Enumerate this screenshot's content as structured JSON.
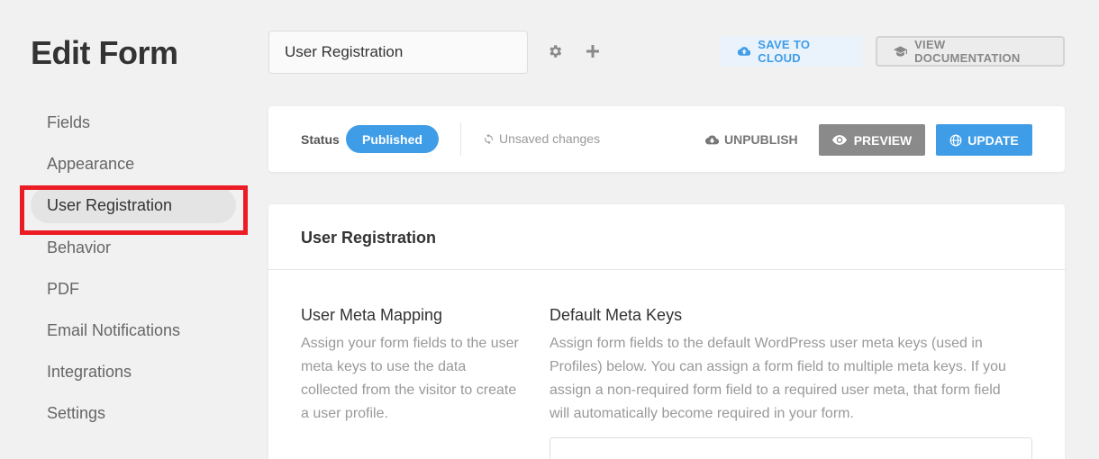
{
  "header": {
    "title": "Edit Form",
    "form_name": "User Registration",
    "save_to_cloud_label": "SAVE TO CLOUD",
    "view_docs_label": "VIEW DOCUMENTATION"
  },
  "sidebar": {
    "items": [
      {
        "label": "Fields"
      },
      {
        "label": "Appearance"
      },
      {
        "label": "User Registration",
        "active": true
      },
      {
        "label": "Behavior"
      },
      {
        "label": "PDF"
      },
      {
        "label": "Email Notifications"
      },
      {
        "label": "Integrations"
      },
      {
        "label": "Settings"
      }
    ]
  },
  "status_bar": {
    "status_label": "Status",
    "status_value": "Published",
    "unsaved_text": "Unsaved changes",
    "unpublish_label": "UNPUBLISH",
    "preview_label": "PREVIEW",
    "update_label": "UPDATE"
  },
  "panel": {
    "title": "User Registration",
    "left_heading": "User Meta Mapping",
    "left_desc": "Assign your form fields to the user meta keys to use the data collected from the visitor to create a user profile.",
    "right_heading": "Default Meta Keys",
    "right_desc": "Assign form fields to the default WordPress user meta keys (used in Profiles) below. You can assign a form field to multiple meta keys. If you assign a non-required form field to a required user meta, that form field will automatically become required in your form."
  },
  "colors": {
    "accent": "#3f9de8",
    "highlight": "#ec1c24",
    "preview_bg": "#8a8a8a"
  }
}
